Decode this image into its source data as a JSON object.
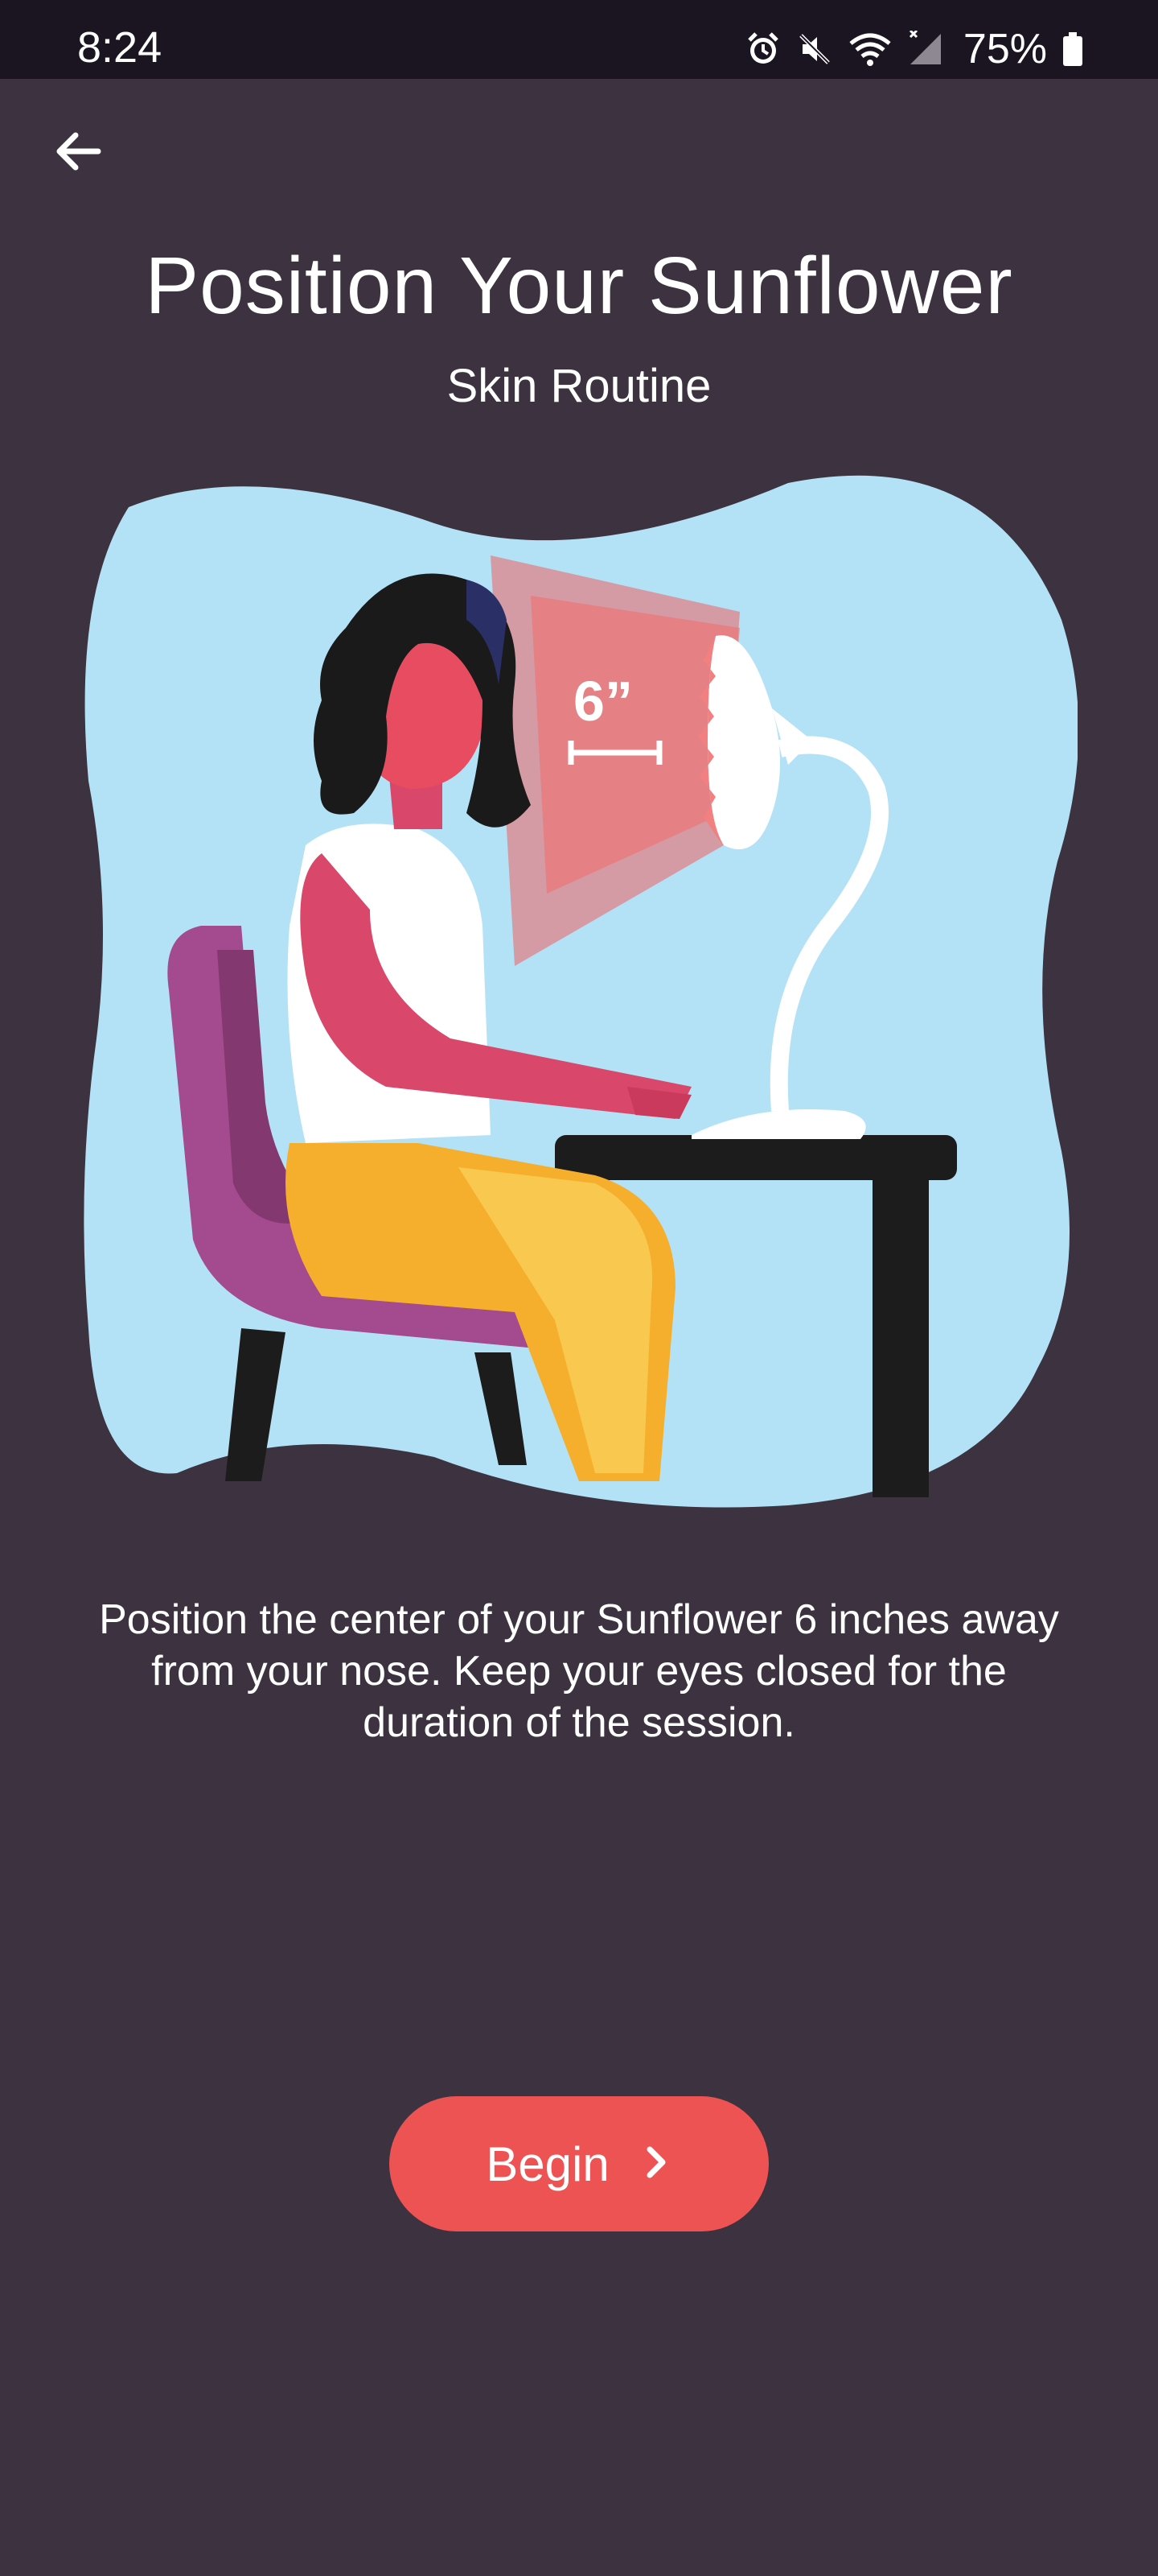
{
  "status_bar": {
    "time": "8:24",
    "battery_percent": "75%",
    "icons": [
      "alarm-icon",
      "mute-icon",
      "wifi-icon",
      "signal-icon",
      "battery-icon"
    ]
  },
  "header": {
    "back_icon": "arrow-left-icon",
    "title": "Position Your Sunflower",
    "subtitle": "Skin Routine"
  },
  "illustration": {
    "distance_label": "6”"
  },
  "instructions": "Position the center of your Sunflower 6 inches away from your nose. Keep your eyes closed for the duration of the session.",
  "begin_button": {
    "label": "Begin",
    "icon": "chevron-right-icon"
  },
  "colors": {
    "background": "#3d323f",
    "status_bar": "#1b1522",
    "accent": "#ee5353",
    "illustration_sky": "#b3e2f6"
  }
}
